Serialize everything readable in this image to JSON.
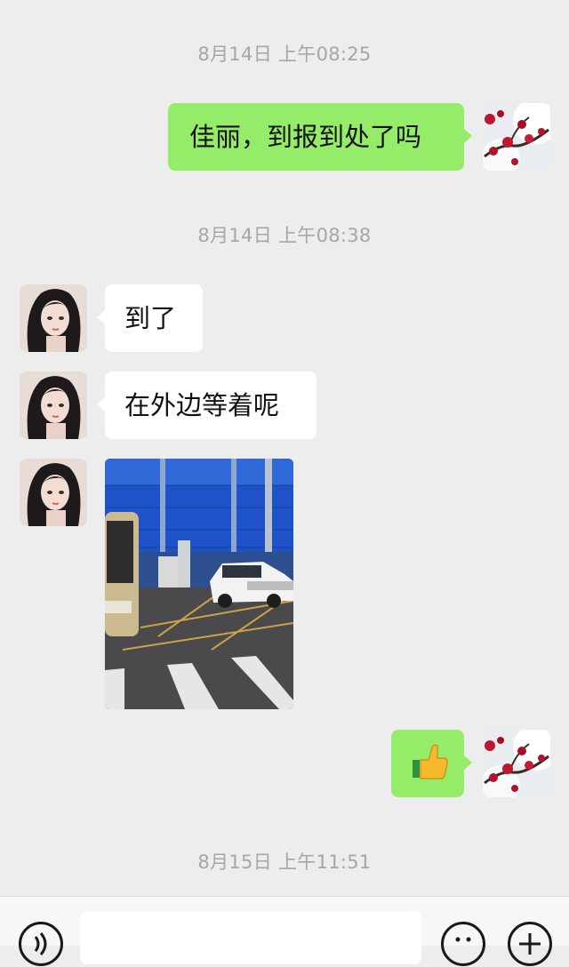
{
  "timestamps": {
    "t1": "8月14日 上午08:25",
    "t2": "8月14日 上午08:38",
    "t3": "8月15日 上午11:51"
  },
  "messages": [
    {
      "side": "me",
      "text": "佳丽，到报到处了吗"
    },
    {
      "side": "other",
      "text": "到了"
    },
    {
      "side": "other",
      "text": "在外边等着呢"
    },
    {
      "side": "other",
      "type": "image"
    },
    {
      "side": "me",
      "type": "emoji",
      "emoji": "thumbs-up"
    }
  ],
  "colors": {
    "background": "#ededed",
    "my_bubble": "#95ec69",
    "their_bubble": "#ffffff",
    "timestamp_text": "#a6a6a6"
  },
  "input_bar": {
    "icons": [
      "voice-icon",
      "emoji-icon",
      "plus-icon"
    ]
  }
}
